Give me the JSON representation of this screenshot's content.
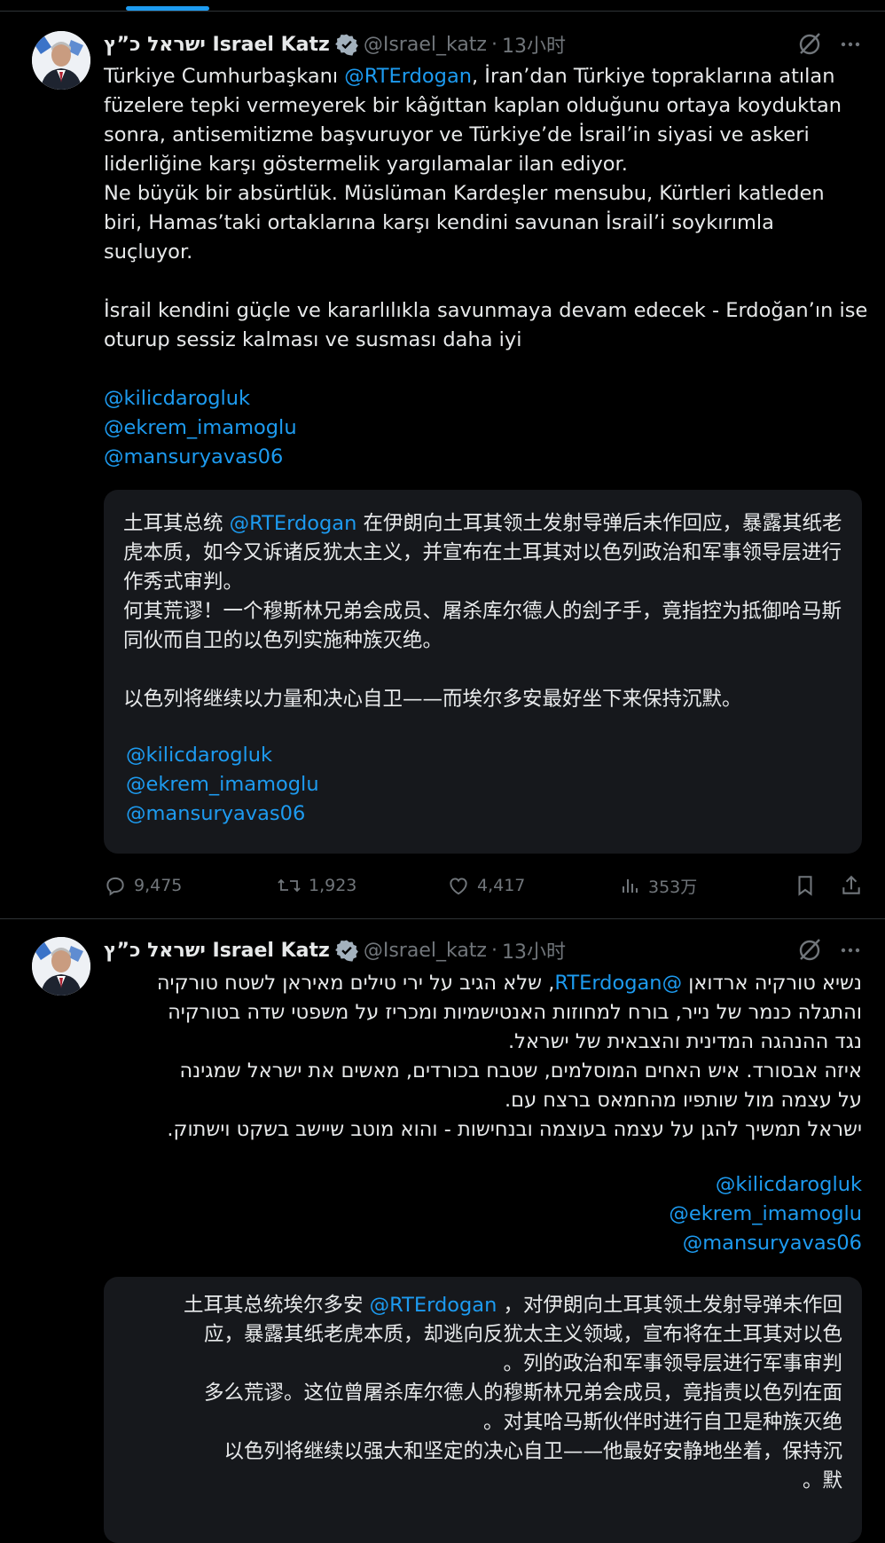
{
  "accent_color": "#1d9bf0",
  "tweet1": {
    "author": {
      "name": "ישראל כ”ץ Israel Katz",
      "handle": "@Israel_katz",
      "time": "13小时",
      "separator": "·"
    },
    "text": {
      "seg1": "Türkiye Cumhurbaşkanı ",
      "mention": "@RTErdogan",
      "seg2": ", İran’dan Türkiye topraklarına atılan füzelere tepki vermeyerek bir kâğıttan kaplan olduğunu ortaya koyduktan sonra, antisemitizme başvuruyor ve Türkiye’de İsrail’in siyasi ve askeri liderliğine karşı göstermelik yargılamalar ilan ediyor.\nNe büyük bir absürtlük. Müslüman Kardeşler mensubu, Kürtleri katleden biri, Hamas’taki ortaklarına karşı kendini savunan İsrail’i soykırımla suçluyor.\n\nİsrail kendini güçle ve kararlılıkla savunmaya devam edecek - Erdoğan’ın ise oturup sessiz kalması ve susması daha iyi"
    },
    "mentions": [
      "@kilicdarogluk",
      "@ekrem_imamoglu",
      "@mansuryavas06"
    ],
    "translation": {
      "seg1": "土耳其总统 ",
      "mention": "@RTErdogan",
      "seg2": " 在伊朗向土耳其领土发射导弹后未作回应，暴露其纸老虎本质，如今又诉诸反犹太主义，并宣布在土耳其对以色列政治和军事领导层进行作秀式审判。\n何其荒谬！一个穆斯林兄弟会成员、屠杀库尔德人的刽子手，竟指控为抵御哈马斯同伙而自卫的以色列实施种族灭绝。\n\n以色列将继续以力量和决心自卫——而埃尔多安最好坐下来保持沉默。",
      "mentions": [
        "@kilicdarogluk",
        "@ekrem_imamoglu",
        "@mansuryavas06"
      ]
    },
    "actions": {
      "replies": "9,475",
      "retweets": "1,923",
      "likes": "4,417",
      "views": "353万"
    }
  },
  "tweet2": {
    "author": {
      "name": "ישראל כ”ץ Israel Katz",
      "handle": "@Israel_katz",
      "time": "13小时",
      "separator": "·"
    },
    "lines": [
      {
        "pre": "נשיא טורקיה ארדואן ",
        "mention": "@RTErdogan",
        "post": ", שלא הגיב על ירי טילים מאיראן לשטח טורקיה"
      },
      {
        "text": "והתגלה כנמר של נייר, בורח למחוזות האנטישמיות ומכריז על משפטי שדה בטורקיה"
      },
      {
        "text": "נגד ההנהגה המדינית והצבאית של ישראל."
      },
      {
        "text": "איזה אבסורד. איש האחים המוסלמים, שטבח בכורדים, מאשים את ישראל שמגינה"
      },
      {
        "text": "על עצמה מול שותפיו מהחמאס  ברצח עם."
      },
      {
        "text": "ישראל תמשיך להגן על עצמה בעוצמה ובנחישות - והוא מוטב שיישב בשקט וישתוק."
      }
    ],
    "mentions": [
      "@kilicdarogluk",
      "@ekrem_imamoglu",
      "@mansuryavas06"
    ],
    "translation": {
      "line1_pre": "土耳其总统埃尔多安 ",
      "line1_mention": "@RTErdogan",
      "line1_post": " ，对伊朗向土耳其领土发射导弹未作回",
      "lines": [
        "应，暴露其纸老虎本质，却逃向反犹太主义领域，宣布将在土耳其对以色",
        "。列的政治和军事领导层进行军事审判",
        "多么荒谬。这位曾屠杀库尔德人的穆斯林兄弟会成员，竟指责以色列在面",
        "。对其哈马斯伙伴时进行自卫是种族灭绝",
        "以色列将继续以强大和坚定的决心自卫——他最好安静地坐着，保持沉",
        "。默"
      ]
    }
  }
}
